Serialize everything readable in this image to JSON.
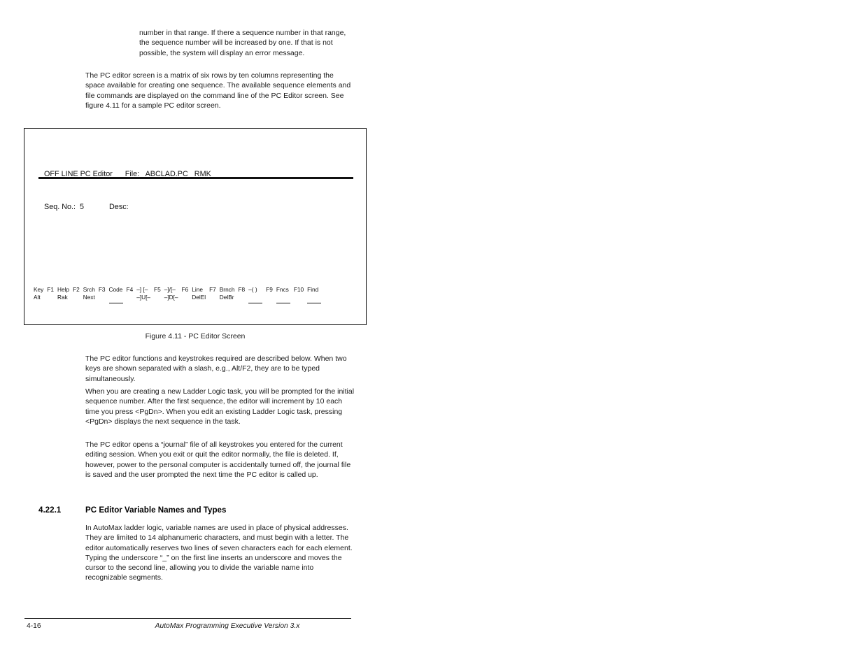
{
  "document": {
    "page_number": "4-16",
    "footer_title": "AutoMax Programming Executive Version 3.x"
  },
  "body": {
    "paragraph_continued": "number in that range. If there a sequence number in that range, the sequence number will be increased by one. If that is not possible, the system will display an error message.",
    "paragraph_matrix": "The PC editor screen is a matrix of six rows by ten columns representing the space available for creating one sequence. The available sequence elements and file commands are displayed on the command line of the PC Editor screen. See figure 4.11 for a sample PC editor screen.",
    "paragraph_functions": "The PC editor functions and keystrokes required are described below. When two keys are shown separated with a slash, e.g., Alt/F2, they are to be typed simultaneously.",
    "paragraph_ladder": "When you are creating a new Ladder Logic task, you will be prompted for the initial sequence number. After the first sequence, the editor will increment by 10 each time you press <PgDn>. When you edit an existing Ladder Logic task, pressing <PgDn> displays the next sequence in the task.",
    "paragraph_journal": "The PC editor opens a “journal” file of all keystrokes you entered for the current editing session. When you exit or quit the editor normally, the file is deleted. If, however, power to the personal computer is accidentally turned off, the journal file is saved and the user prompted the next time the PC editor is called up."
  },
  "figure": {
    "caption": "Figure 4.11 - PC Editor Screen",
    "screen": {
      "line1": "OFF LINE PC Editor      File:   ABCLAD.PC   RMK",
      "line2": "Seq. No.:  5            Desc:",
      "mode_label": "OFF LINE PC Editor",
      "file_label": "File:",
      "file_value": "ABCLAD.PC",
      "user_initials": "RMK",
      "seq_label": "Seq. No.:",
      "seq_value": "5",
      "desc_label": "Desc:"
    },
    "function_keys": [
      {
        "top": "Key",
        "bottom": "Alt",
        "underline": false
      },
      {
        "top": "F1",
        "bottom": "",
        "underline": false
      },
      {
        "top": "Help",
        "bottom": "Rak",
        "underline": false
      },
      {
        "top": "F2",
        "bottom": "",
        "underline": false
      },
      {
        "top": "Srch",
        "bottom": "Next",
        "underline": false
      },
      {
        "top": "F3",
        "bottom": "",
        "underline": false
      },
      {
        "top": "Code",
        "bottom": "",
        "underline": true
      },
      {
        "top": "F4",
        "bottom": "",
        "underline": false
      },
      {
        "top": "–] [–",
        "bottom": "–]U[–",
        "underline": false
      },
      {
        "top": "F5",
        "bottom": "",
        "underline": false
      },
      {
        "top": "–]/[–",
        "bottom": "–]D[–",
        "underline": false
      },
      {
        "top": "F6",
        "bottom": "",
        "underline": false
      },
      {
        "top": "Line",
        "bottom": "DelEl",
        "underline": false
      },
      {
        "top": "F7",
        "bottom": "",
        "underline": false
      },
      {
        "top": "Brnch",
        "bottom": "DelBr",
        "underline": false
      },
      {
        "top": "F8",
        "bottom": "",
        "underline": false
      },
      {
        "top": "–( )",
        "bottom": "",
        "underline": true
      },
      {
        "top": "F9",
        "bottom": "",
        "underline": false
      },
      {
        "top": "Fncs",
        "bottom": "",
        "underline": true
      },
      {
        "top": "F10",
        "bottom": "",
        "underline": false
      },
      {
        "top": "Find",
        "bottom": "",
        "underline": true
      }
    ]
  },
  "section": {
    "number": "4.22.1",
    "title": "PC Editor Variable Names and Types",
    "paragraph": "In AutoMax ladder logic, variable names are used in place of physical addresses. They are limited to 14 alphanumeric characters, and must begin with a letter. The editor automatically reserves two lines of seven characters each for each element. Typing the underscore “_” on the first line inserts an underscore and moves the cursor to the second line, allowing you to divide the variable name into recognizable segments."
  }
}
